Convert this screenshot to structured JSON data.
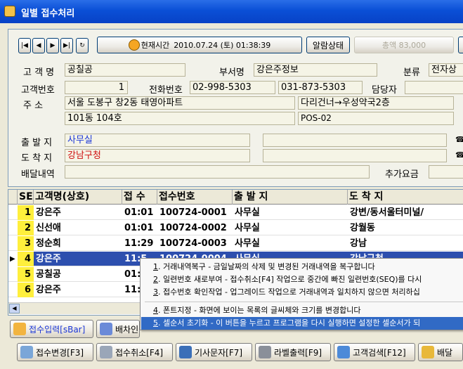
{
  "window": {
    "title": "일별 접수처리"
  },
  "toolbar": {
    "nav": [
      "|◀",
      "◀",
      "▶",
      "▶|",
      "↻"
    ],
    "clock_label": "현재시간",
    "clock_value": "2010.07.24 (토) 01:38:39",
    "alarm_label": "알람상태",
    "total_label": "총액 83,000"
  },
  "customer": {
    "name_label": "고 객 명",
    "name": "공칠공",
    "dept_label": "부서명",
    "dept": "강은주정보",
    "category_label": "분류",
    "category": "전자상",
    "no_label": "고객번호",
    "no": "1",
    "phone_label": "전화번호",
    "phone1": "02-998-5303",
    "phone2": "031-873-5303",
    "manager_label": "담당자",
    "address_label": "주      소",
    "address1": "서울 도봉구 창2동 태영아파트",
    "address2": "101동 104호",
    "address_note1": "다리건너→우성약국2층",
    "address_note2": "POS-02"
  },
  "delivery": {
    "origin_label": "출 발 지",
    "origin": "사무실",
    "dest_label": "도 착 지",
    "dest": "강남구청",
    "history_label": "배달내역",
    "extra_fee_label": "추가요금"
  },
  "table": {
    "headers": [
      "SE",
      "고객명(상호)",
      "접 수",
      "접수번호",
      "출 발 지",
      "도 착 지"
    ],
    "rows": [
      {
        "seq": "1",
        "name": "강은주",
        "time": "01:01",
        "no": "100724-0001",
        "origin": "사무실",
        "dest": "강변/동서울터미널/"
      },
      {
        "seq": "2",
        "name": "신선애",
        "time": "01:01",
        "no": "100724-0002",
        "origin": "사무실",
        "dest": "강월동"
      },
      {
        "seq": "3",
        "name": "정순희",
        "time": "11:29",
        "no": "100724-0003",
        "origin": "사무실",
        "dest": "강남"
      },
      {
        "seq": "4",
        "name": "강은주",
        "time": "11:5",
        "no": "100724-0004",
        "origin": "사무실",
        "dest": "강남구청"
      },
      {
        "seq": "5",
        "name": "공칠공",
        "time": "01:",
        "no": "",
        "origin": "",
        "dest": ""
      },
      {
        "seq": "6",
        "name": "강은주",
        "time": "11:",
        "no": "",
        "origin": "",
        "dest": ""
      }
    ]
  },
  "context_menu": {
    "items": [
      {
        "key": "1",
        "text": ". 거래내역복구 - 금일날짜의 삭제 및 변경된 거래내역을 복구합니다"
      },
      {
        "key": "2",
        "text": ". 일련번호 새로부여 - 접수취소[F4] 작업으로 중간에 빠진 일련번호(SEQ)를 다시"
      },
      {
        "key": "3",
        "text": ". 접수번호 확인작업 - 업그레이드 작업으로 거래내역과 일치하지 않으면 처리하십"
      },
      {
        "key": "4",
        "text": ". 폰트지정 - 화면에 보이는 목록의 글씨체와 크기를 변경합니다"
      },
      {
        "key": "5",
        "text": ". 셀순서 초기화 - 이 버튼을 누르고 프로그램을 다시 실행하면 설정한 셀순서가 되"
      }
    ]
  },
  "buttons": {
    "row1": [
      "접수입력[sBar]",
      "배차인"
    ],
    "row2": [
      "접수변경[F3]",
      "접수취소[F4]",
      "기사문자[F7]",
      "라벨출력[F9]",
      "고객검색[F12]",
      "배달"
    ]
  },
  "colors": {
    "title_bar": "#0a4fd6",
    "selection": "#2d4fae",
    "seq_highlight": "#ffef3c",
    "menu_highlight": "#316ac5"
  }
}
